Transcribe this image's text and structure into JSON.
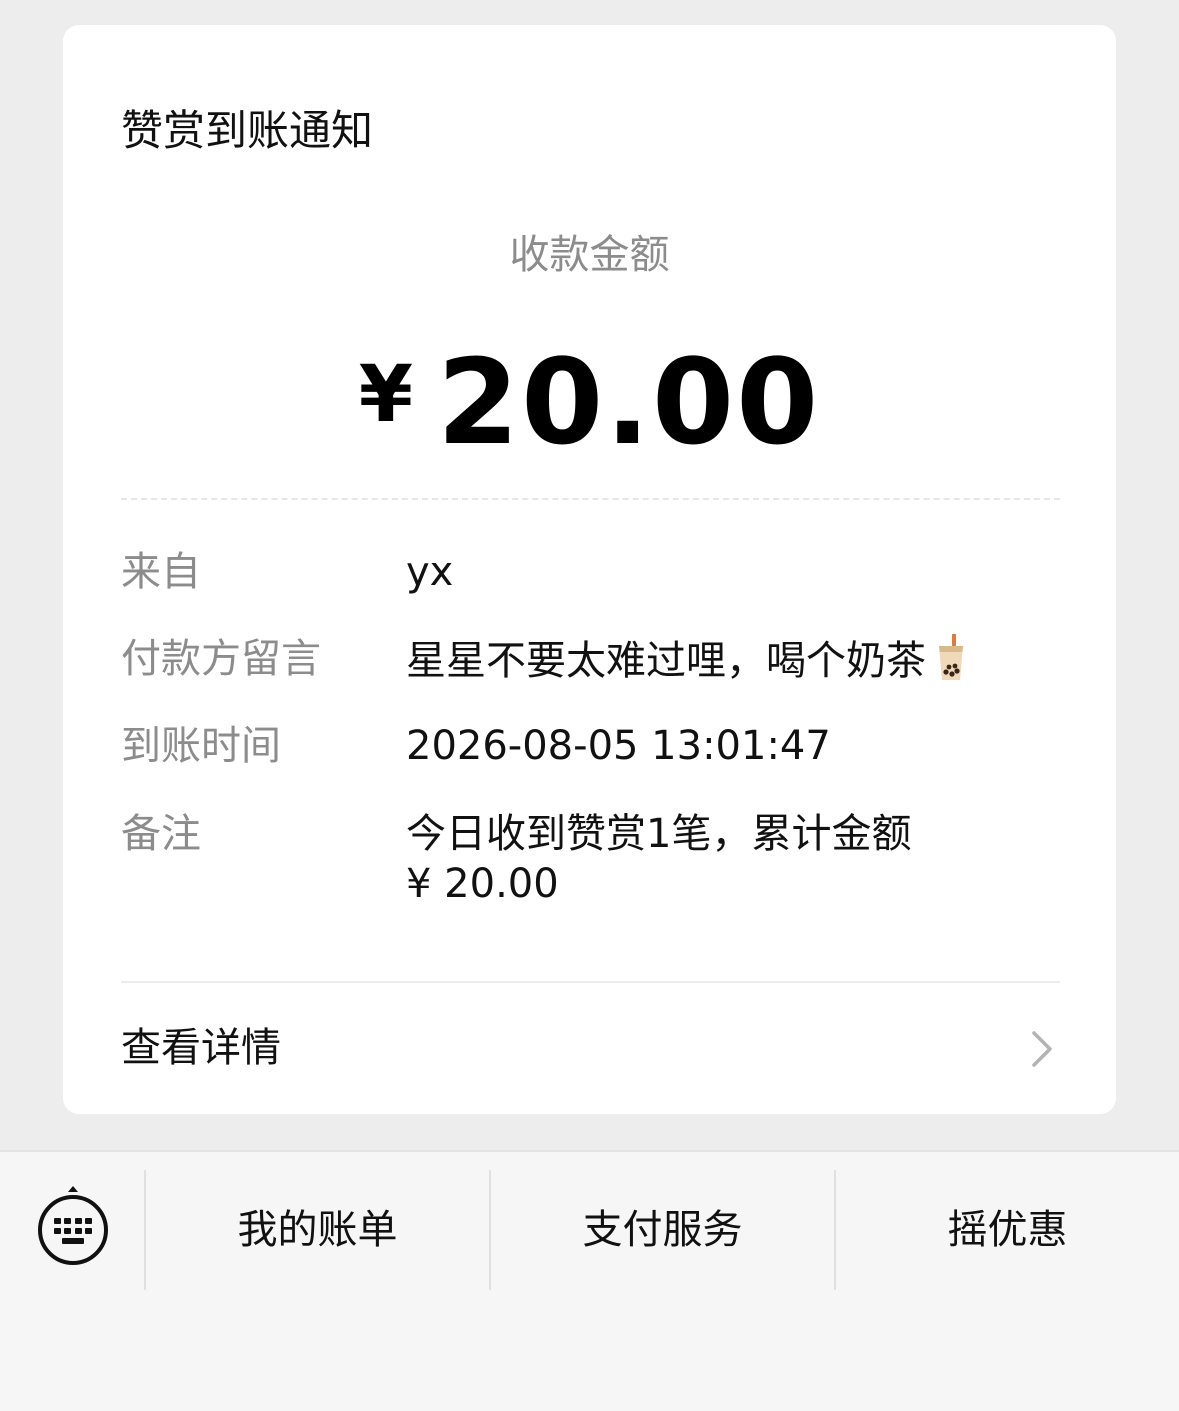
{
  "card": {
    "title": "赞赏到账通知",
    "amount_label": "收款金额",
    "amount_currency": "¥",
    "amount_value": "20.00",
    "rows": [
      {
        "key": "来自",
        "value": "yx"
      },
      {
        "key": "付款方留言",
        "value": "星星不要太难过哩，喝个奶茶",
        "emoji": "bubble-tea-icon"
      },
      {
        "key": "到账时间",
        "value": "2026-08-05 13:01:47"
      },
      {
        "key": "备注",
        "value_line1": "今日收到赞赏1笔，累计金额",
        "value_line2": "¥ 20.00"
      }
    ],
    "details_label": "查看详情"
  },
  "tabbar": {
    "keyboard_icon": "keyboard-toggle-icon",
    "tabs": [
      {
        "label": "我的账单"
      },
      {
        "label": "支付服务"
      },
      {
        "label": "摇优惠"
      }
    ]
  }
}
